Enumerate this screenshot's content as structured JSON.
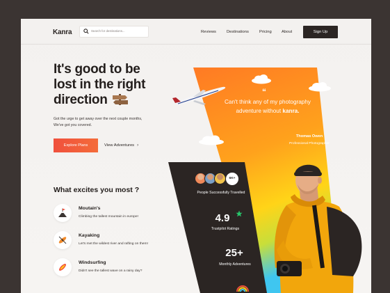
{
  "brand": {
    "name": "Kanra"
  },
  "search": {
    "placeholder": "Search for destinations..."
  },
  "nav": {
    "links": [
      "Reviews",
      "Destinations",
      "Pricing",
      "About"
    ],
    "signup_label": "Sign Up"
  },
  "hero": {
    "title": "It's good to be lost in the right direction",
    "subtitle": "Got the urge to get away over the next couple months, We've got you covered.",
    "explore_label": "Explore Plans",
    "view_label": "View Adventures",
    "view_chevron": "›"
  },
  "excites": {
    "heading": "What excites you most ?",
    "items": [
      {
        "title": "Moutain's",
        "desc": "Climbing the tallest mountain in europe!",
        "icon": "mountain-flag-icon"
      },
      {
        "title": "Kayaking",
        "desc": "Let's met the wildest river and rafting on them!",
        "icon": "kayak-icon"
      },
      {
        "title": "Windsurfing",
        "desc": "Didn't see the tallest wave on a rainy day?",
        "icon": "surfboard-icon"
      }
    ]
  },
  "testimonial": {
    "quote_mark": "“",
    "quote_text": "Can't think any of my photography adventure without",
    "quote_brand": "kanra.",
    "author": "Thomas Owen",
    "role": "Professional Photographer"
  },
  "stats": {
    "badge": "6K+",
    "travelled_label": "People Successfully Travelled",
    "rating_value": "4.9",
    "rating_label": "Trustpilot Ratings",
    "adventures_value": "25+",
    "adventures_label": "Monthly Adventures"
  },
  "colors": {
    "accent": "#f0503c",
    "dark": "#2b2523",
    "orange": "#ff8a2a",
    "yellow": "#ffd21a",
    "cyan": "#3fc6f0",
    "star": "#27c56a"
  }
}
